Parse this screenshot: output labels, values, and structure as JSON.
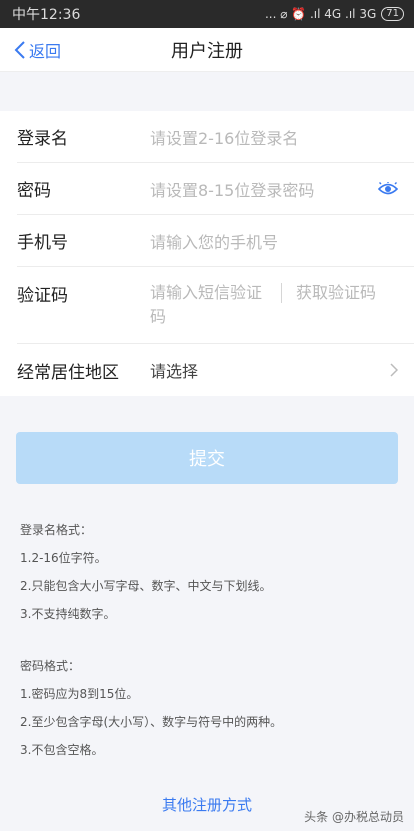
{
  "status_bar": {
    "time": "中午12:36",
    "indicators": "... ⌀ ⏰ .ıl 4G .ıl 3G",
    "battery": "71"
  },
  "nav": {
    "back_label": "返回",
    "title": "用户注册"
  },
  "form": {
    "username": {
      "label": "登录名",
      "placeholder": "请设置2-16位登录名"
    },
    "password": {
      "label": "密码",
      "placeholder": "请设置8-15位登录密码"
    },
    "phone": {
      "label": "手机号",
      "placeholder": "请输入您的手机号"
    },
    "sms": {
      "label": "验证码",
      "placeholder": "请输入短信验证码",
      "get_code": "获取验证码"
    },
    "region": {
      "label": "经常居住地区",
      "value": "请选择"
    }
  },
  "submit_label": "提交",
  "notes": {
    "username_title": "登录名格式：",
    "username_rules": [
      "1.2-16位字符。",
      "2.只能包含大小写字母、数字、中文与下划线。",
      "3.不支持纯数字。"
    ],
    "password_title": "密码格式：",
    "password_rules": [
      "1.密码应为8到15位。",
      "2.至少包含字母(大小写）、数字与符号中的两种。",
      "3.不包含空格。"
    ]
  },
  "alt_register": "其他注册方式",
  "watermark": "头条 @办税总动员",
  "colors": {
    "accent": "#3a7af0",
    "submit_disabled": "#b8dbf8"
  }
}
